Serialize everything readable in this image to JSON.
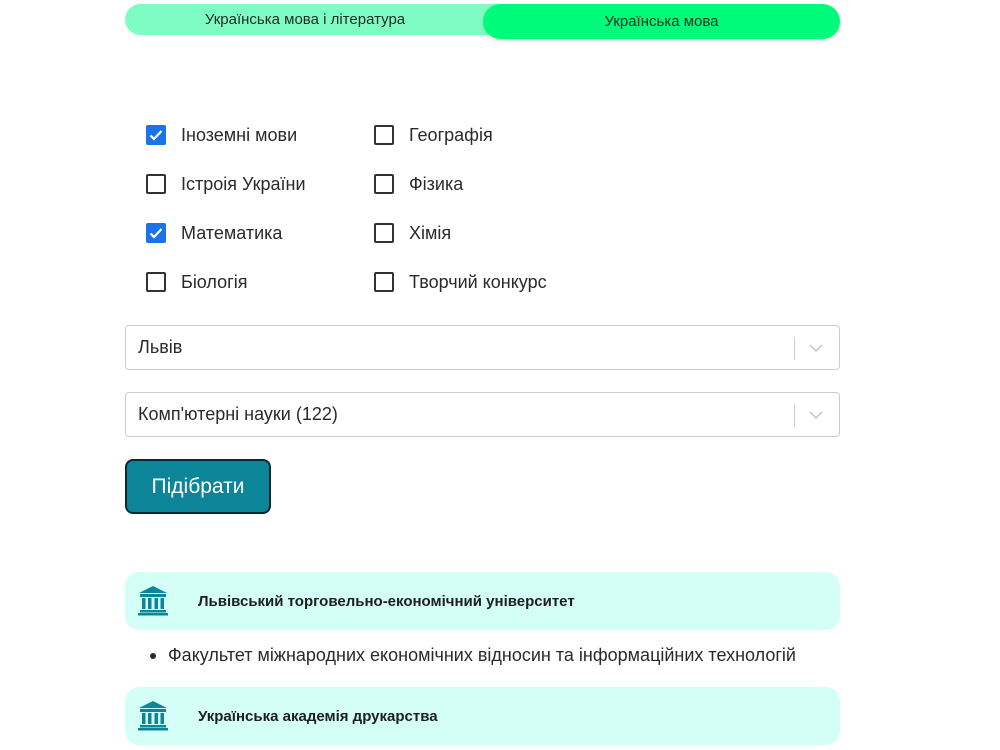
{
  "tabs": [
    {
      "label": "Українська мова і література",
      "active": false
    },
    {
      "label": "Українська мова",
      "active": true
    }
  ],
  "subjects": {
    "column1": [
      {
        "label": "Іноземні мови",
        "checked": true
      },
      {
        "label": "Істроія України",
        "checked": false
      },
      {
        "label": "Математика",
        "checked": true
      },
      {
        "label": "Біологія",
        "checked": false
      }
    ],
    "column2": [
      {
        "label": "Географія",
        "checked": false
      },
      {
        "label": "Фізика",
        "checked": false
      },
      {
        "label": "Хімія",
        "checked": false
      },
      {
        "label": "Творчий конкурс",
        "checked": false
      }
    ]
  },
  "city_select": {
    "value": "Львів",
    "icon": "chevron-down-icon"
  },
  "specialty_select": {
    "value": "Комп'ютерні науки (122)",
    "icon": "chevron-down-icon"
  },
  "submit_button": {
    "label": "Підібрати"
  },
  "results": [
    {
      "university": "Львівський торговельно-економічний університет",
      "icon": "university-building-icon",
      "faculties": [
        "Факультет міжнародних економічних відносин та інформаційних технологій"
      ]
    },
    {
      "university": "Українська академія друкарства",
      "icon": "university-building-icon",
      "faculties": []
    }
  ],
  "colors": {
    "tab_inactive": "#7ffcc4",
    "tab_active": "#00fa7a",
    "checkbox_checked": "#1a73e8",
    "button": "#0c8599",
    "result_card": "#d4fff6",
    "icon": "#0c8599"
  }
}
